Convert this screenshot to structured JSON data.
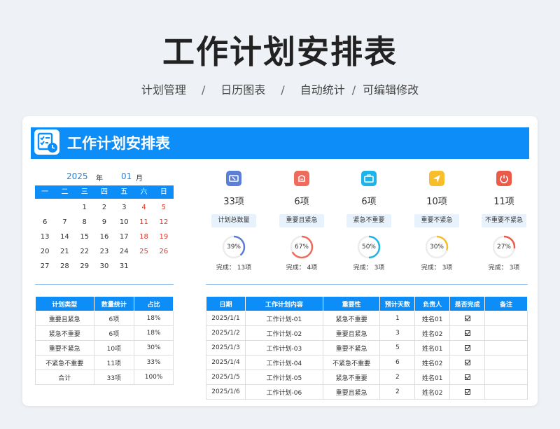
{
  "title": "工作计划安排表",
  "subtitle": [
    "计划管理",
    "日历图表",
    "自动统计",
    "可编辑修改"
  ],
  "subtitle_separators": [
    "/",
    "/",
    "/"
  ],
  "banner_title": "工作计划安排表",
  "calendar": {
    "year": "2025",
    "year_label": "年",
    "month": "01",
    "month_label": "月",
    "weekdays": [
      "一",
      "二",
      "三",
      "四",
      "五",
      "六",
      "日"
    ],
    "weeks": [
      [
        "",
        "",
        "1",
        "2",
        "3",
        "4",
        "5"
      ],
      [
        "6",
        "7",
        "8",
        "9",
        "10",
        "11",
        "12"
      ],
      [
        "13",
        "14",
        "15",
        "16",
        "17",
        "18",
        "19"
      ],
      [
        "20",
        "21",
        "22",
        "23",
        "24",
        "25",
        "26"
      ],
      [
        "27",
        "28",
        "29",
        "30",
        "31",
        "",
        ""
      ]
    ]
  },
  "stats": [
    {
      "count": "33项",
      "label": "计划总数量",
      "percent_text": "39%",
      "percent": 39,
      "done": "完成： 13项",
      "icon": "ticket-icon",
      "color": "#5b7ed6"
    },
    {
      "count": "6项",
      "label": "重要且紧急",
      "percent_text": "67%",
      "percent": 67,
      "done": "完成： 4项",
      "icon": "money-bag-icon",
      "color": "#ef6b5e"
    },
    {
      "count": "6项",
      "label": "紧急不重要",
      "percent_text": "50%",
      "percent": 50,
      "done": "完成： 3项",
      "icon": "briefcase-icon",
      "color": "#1fb3e8"
    },
    {
      "count": "10项",
      "label": "重要不紧急",
      "percent_text": "30%",
      "percent": 30,
      "done": "完成： 3项",
      "icon": "navigation-icon",
      "color": "#f7be2a"
    },
    {
      "count": "11项",
      "label": "不重要不紧急",
      "percent_text": "27%",
      "percent": 27,
      "done": "完成： 3项",
      "icon": "power-icon",
      "color": "#ee5a4a"
    }
  ],
  "summary_table": {
    "headers": [
      "计划类型",
      "数量统计",
      "占比"
    ],
    "rows": [
      [
        "重要且紧急",
        "6项",
        "18%"
      ],
      [
        "紧急不重要",
        "6项",
        "18%"
      ],
      [
        "重要不紧急",
        "10项",
        "30%"
      ],
      [
        "不紧急不重要",
        "11项",
        "33%"
      ],
      [
        "合计",
        "33项",
        "100%"
      ]
    ]
  },
  "plan_table": {
    "headers": [
      "日期",
      "工作计划内容",
      "重要性",
      "预计天数",
      "负责人",
      "是否完成",
      "备注"
    ],
    "rows": [
      [
        "2025/1/1",
        "工作计划-01",
        "紧急不重要",
        "1",
        "姓名01",
        "check",
        ""
      ],
      [
        "2025/1/2",
        "工作计划-02",
        "重要且紧急",
        "3",
        "姓名02",
        "check",
        ""
      ],
      [
        "2025/1/3",
        "工作计划-03",
        "重要不紧急",
        "5",
        "姓名01",
        "check",
        ""
      ],
      [
        "2025/1/4",
        "工作计划-04",
        "不紧急不重要",
        "6",
        "姓名02",
        "check",
        ""
      ],
      [
        "2025/1/5",
        "工作计划-05",
        "紧急不重要",
        "2",
        "姓名01",
        "check",
        ""
      ],
      [
        "2025/1/6",
        "工作计划-06",
        "重要且紧急",
        "2",
        "姓名02",
        "check",
        ""
      ]
    ]
  }
}
